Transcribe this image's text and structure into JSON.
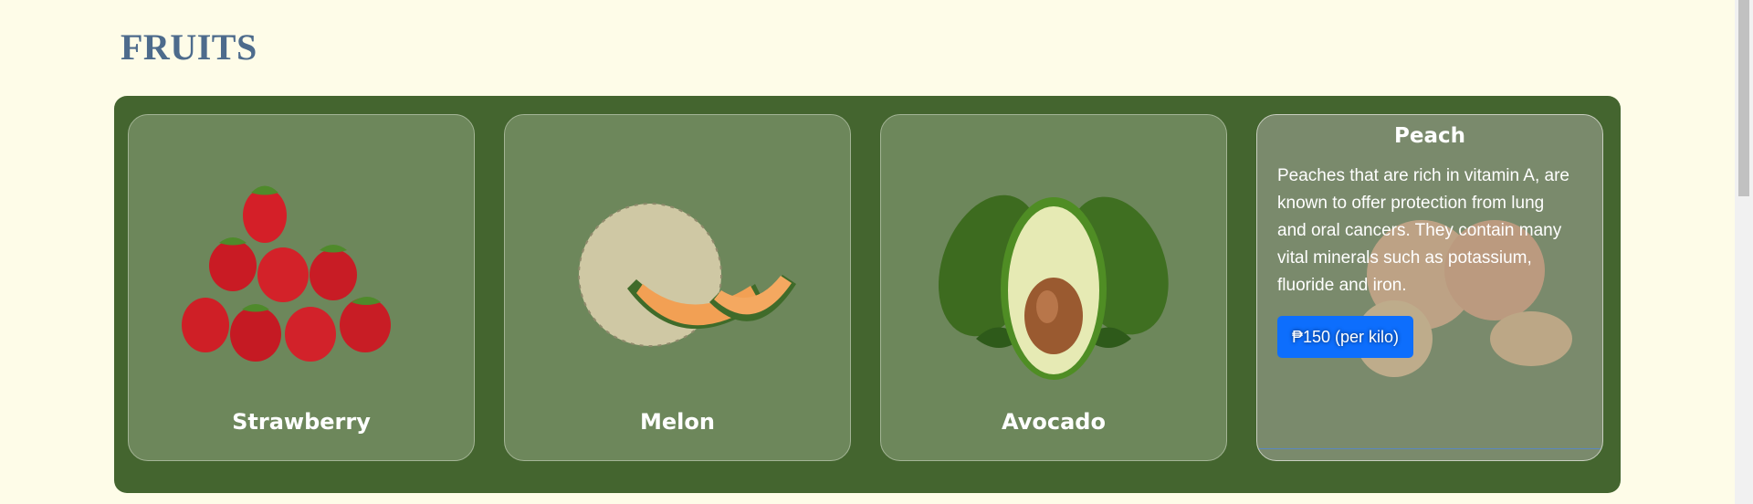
{
  "page": {
    "title": "FRUITS"
  },
  "cards": [
    {
      "name": "Strawberry"
    },
    {
      "name": "Melon"
    },
    {
      "name": "Avocado"
    },
    {
      "name": "Peach",
      "description": "Peaches that are rich in vitamin A, are known to offer protection from lung and oral cancers. They contain many vital minerals such as potassium, fluoride and iron.",
      "price": "₱150 (per kilo)"
    }
  ],
  "colors": {
    "background": "#fefce8",
    "title": "#4d6b8c",
    "panel": "#44652f",
    "card": "#6d875b",
    "button": "#0d6efd"
  }
}
